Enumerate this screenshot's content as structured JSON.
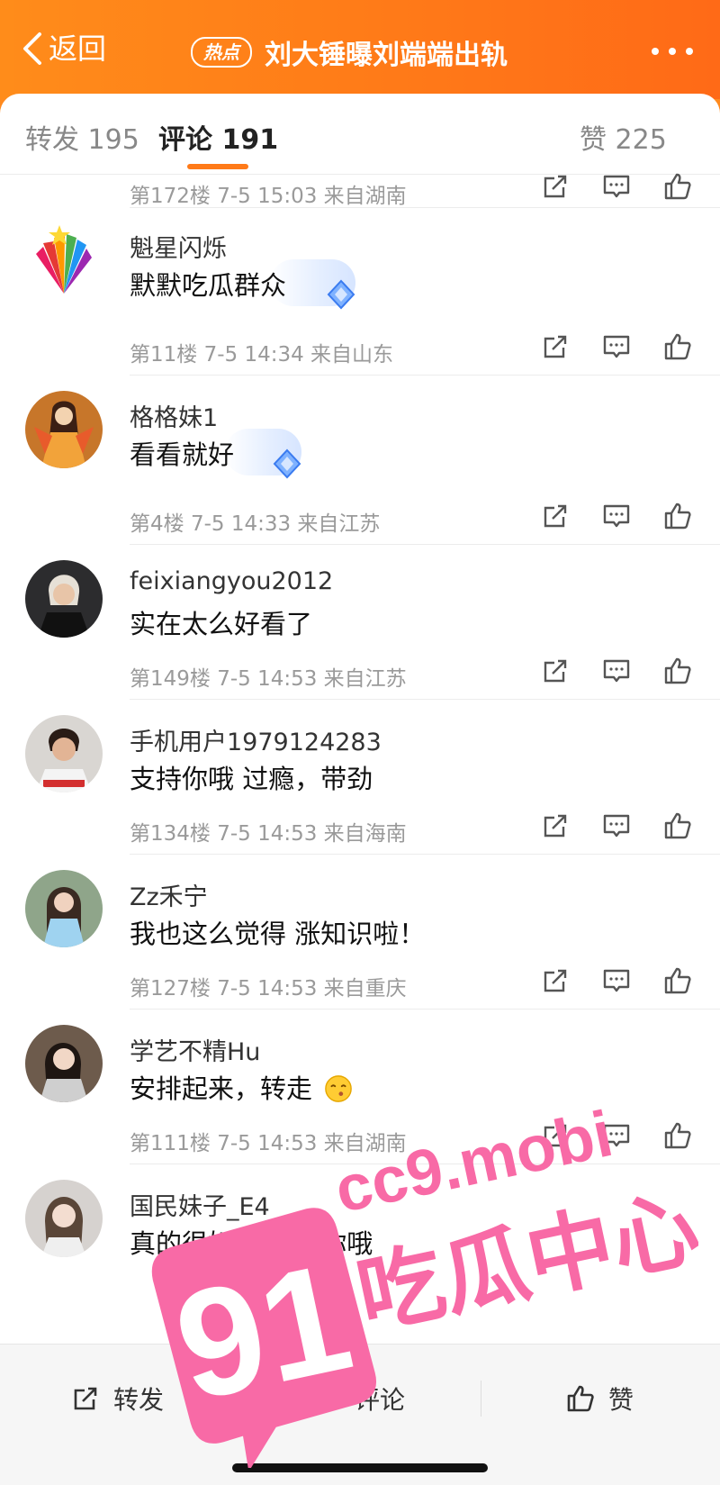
{
  "header": {
    "back_label": "返回",
    "hot_badge": "热点",
    "title": "刘大锤曝刘端端出轨"
  },
  "tabs": [
    {
      "label": "转发 195"
    },
    {
      "label": "评论 191"
    },
    {
      "label": "赞 225"
    }
  ],
  "top_meta": "第172楼 7-5 15:03 来自湖南",
  "comments": [
    {
      "username": "魁星闪烁",
      "text": "默默吃瓜群众",
      "meta": "第11楼 7-5 14:34 来自山东"
    },
    {
      "username": "格格妹1",
      "text": "看看就好",
      "meta": "第4楼 7-5 14:33 来自江苏"
    },
    {
      "username": "feixiangyou2012",
      "text": "实在太么好看了",
      "meta": "第149楼 7-5 14:53 来自江苏"
    },
    {
      "username": "手机用户1979124283",
      "text": "支持你哦 过瘾，带劲",
      "meta": "第134楼 7-5 14:53 来自海南"
    },
    {
      "username": "Zz禾宁",
      "text": "我也这么觉得 涨知识啦！",
      "meta": "第127楼 7-5 14:53 来自重庆"
    },
    {
      "username": "学艺不精Hu",
      "text": "安排起来，转走",
      "meta": "第111楼 7-5 14:53 来自湖南"
    },
    {
      "username": "国民妹子_E4",
      "text": "真的很好哎 支持你哦",
      "meta": ""
    }
  ],
  "bottom_bar": {
    "repost_label": "转发",
    "comment_label": "评论",
    "like_label": "赞"
  },
  "watermark": {
    "number": "91",
    "url": "cc9.mobi",
    "tagline": "吃瓜中心"
  },
  "colors": {
    "brand_orange": "#ff7a18",
    "watermark_pink": "#f86aa6"
  },
  "icons": [
    "chevron-left-icon",
    "more-dots-icon",
    "share-icon",
    "comment-icon",
    "thumbs-up-icon"
  ]
}
